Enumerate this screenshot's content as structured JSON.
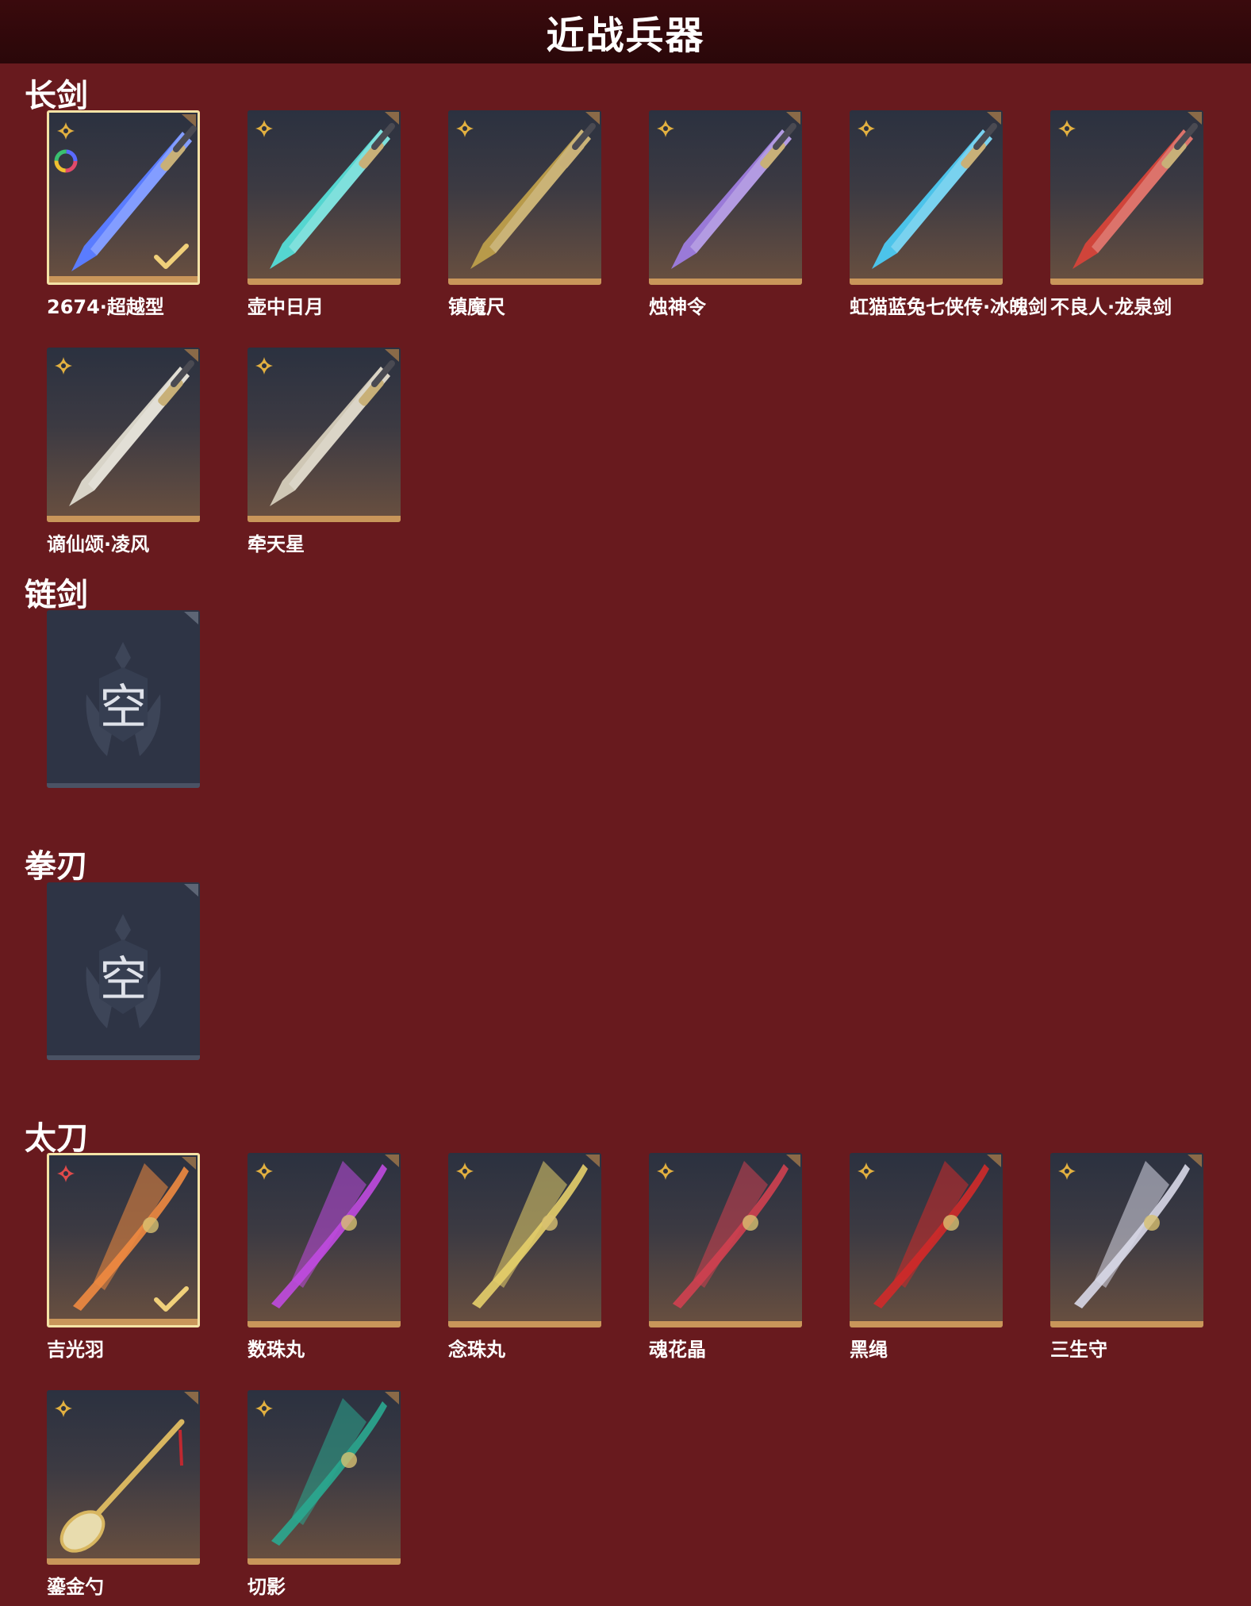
{
  "header": {
    "title": "近战兵器"
  },
  "colors": {
    "background": "#681a1e",
    "header": "#2a0709",
    "card_top": "#2b3140",
    "card_bottom": "#6a5040",
    "card_strip": "#c9965a",
    "selected_border": "#f4e3a6",
    "empty_card": "#2e3445"
  },
  "categories": [
    {
      "title": "长剑",
      "items": [
        {
          "name": "2674·超越型",
          "icon": "sword-icon",
          "selected": true,
          "badge": "gold-star",
          "ring": true,
          "color": "#5a7cff"
        },
        {
          "name": "壶中日月",
          "icon": "sword-icon",
          "selected": false,
          "badge": "gold-star",
          "color": "#55d6d0"
        },
        {
          "name": "镇魔尺",
          "icon": "sword-icon",
          "selected": false,
          "badge": "gold-star",
          "color": "#b89a4a"
        },
        {
          "name": "烛神令",
          "icon": "sword-icon",
          "selected": false,
          "badge": "gold-star",
          "color": "#9a7ad8"
        },
        {
          "name": "虹猫蓝兔七侠传·冰魄剑",
          "icon": "sword-icon",
          "selected": false,
          "badge": "gold-star",
          "color": "#4cc3ea"
        },
        {
          "name": "不良人·龙泉剑",
          "icon": "sword-icon",
          "selected": false,
          "badge": "gold-star",
          "color": "#d0443a"
        },
        {
          "name": "谪仙颂·凌风",
          "icon": "sword-icon",
          "selected": false,
          "badge": "gold-star",
          "color": "#d8d4c8"
        },
        {
          "name": "牵天星",
          "icon": "sword-icon",
          "selected": false,
          "badge": "gold-star",
          "color": "#cfc7b5"
        }
      ]
    },
    {
      "title": "链剑",
      "empty": true,
      "empty_text": "空"
    },
    {
      "title": "拳刃",
      "empty": true,
      "empty_text": "空"
    },
    {
      "title": "太刀",
      "items": [
        {
          "name": "吉光羽",
          "icon": "katana-icon",
          "selected": true,
          "badge": "red-star",
          "color": "#f08a40"
        },
        {
          "name": "数珠丸",
          "icon": "katana-icon",
          "selected": false,
          "badge": "gold-star",
          "color": "#c04ae0"
        },
        {
          "name": "念珠丸",
          "icon": "katana-icon",
          "selected": false,
          "badge": "gold-star",
          "color": "#e6cf6a"
        },
        {
          "name": "魂花晶",
          "icon": "katana-icon",
          "selected": false,
          "badge": "gold-star",
          "color": "#d04050"
        },
        {
          "name": "黑绳",
          "icon": "katana-icon",
          "selected": false,
          "badge": "gold-star",
          "color": "#d02a2a"
        },
        {
          "name": "三生守",
          "icon": "katana-icon",
          "selected": false,
          "badge": "gold-star",
          "color": "#d8d8e8"
        },
        {
          "name": "鎏金勺",
          "icon": "spoon-icon",
          "selected": false,
          "badge": "gold-star",
          "color": "#d8b660"
        },
        {
          "name": "切影",
          "icon": "katana-icon",
          "selected": false,
          "badge": "gold-star",
          "color": "#2aa890"
        }
      ]
    }
  ]
}
